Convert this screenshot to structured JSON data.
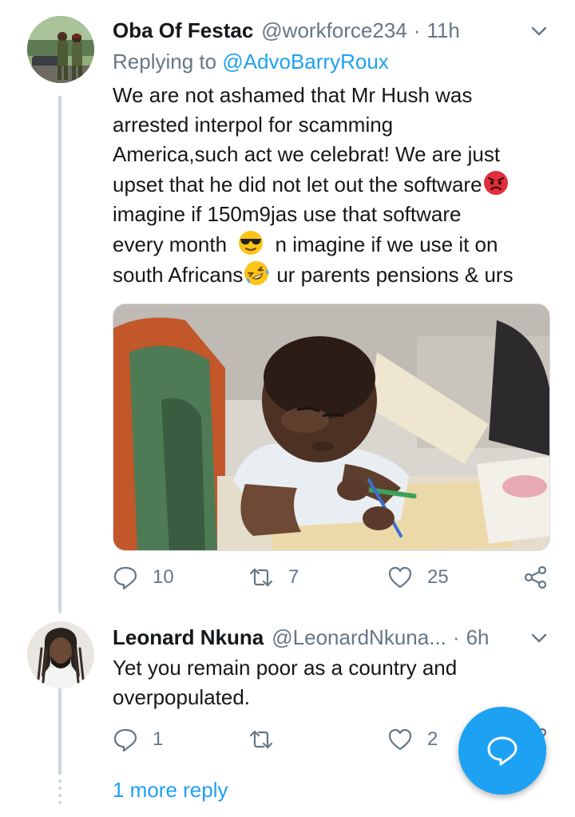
{
  "tweets": [
    {
      "name": "Oba Of Festac",
      "handle": "@workforce234",
      "separator": "·",
      "time": "11h",
      "replying_prefix": "Replying to ",
      "replying_to": "@AdvoBarryRoux",
      "lines": [
        "We are not ashamed that Mr Hush was",
        "arrested interpol for scamming",
        "America,such act we celebrat! We are just",
        "upset that he did not let out the software",
        "imagine if 150m9jas use that software",
        "every month",
        "n imagine if we use it on",
        "south Africans",
        "ur parents pensions & urs"
      ],
      "emojis": [
        "angry-face-emoji",
        "sunglasses-face-emoji",
        "rofl-face-emoji"
      ],
      "replies": "10",
      "retweets": "7",
      "likes": "25"
    },
    {
      "name": "Leonard Nkuna",
      "handle": "@LeonardNkuna...",
      "separator": "·",
      "time": "6h",
      "lines": [
        "Yet you remain poor as a country and",
        "overpopulated."
      ],
      "replies": "1",
      "retweets": "",
      "likes": "2"
    }
  ],
  "more_replies": "1 more reply",
  "colors": {
    "accent": "#1da1f2",
    "secondary_text": "#657786",
    "thread_line": "#ccd6dd",
    "primary_text": "#14171a"
  },
  "icons": [
    "reply-icon",
    "retweet-icon",
    "like-icon",
    "share-icon",
    "chevron-down-icon",
    "compose-reply-icon"
  ]
}
